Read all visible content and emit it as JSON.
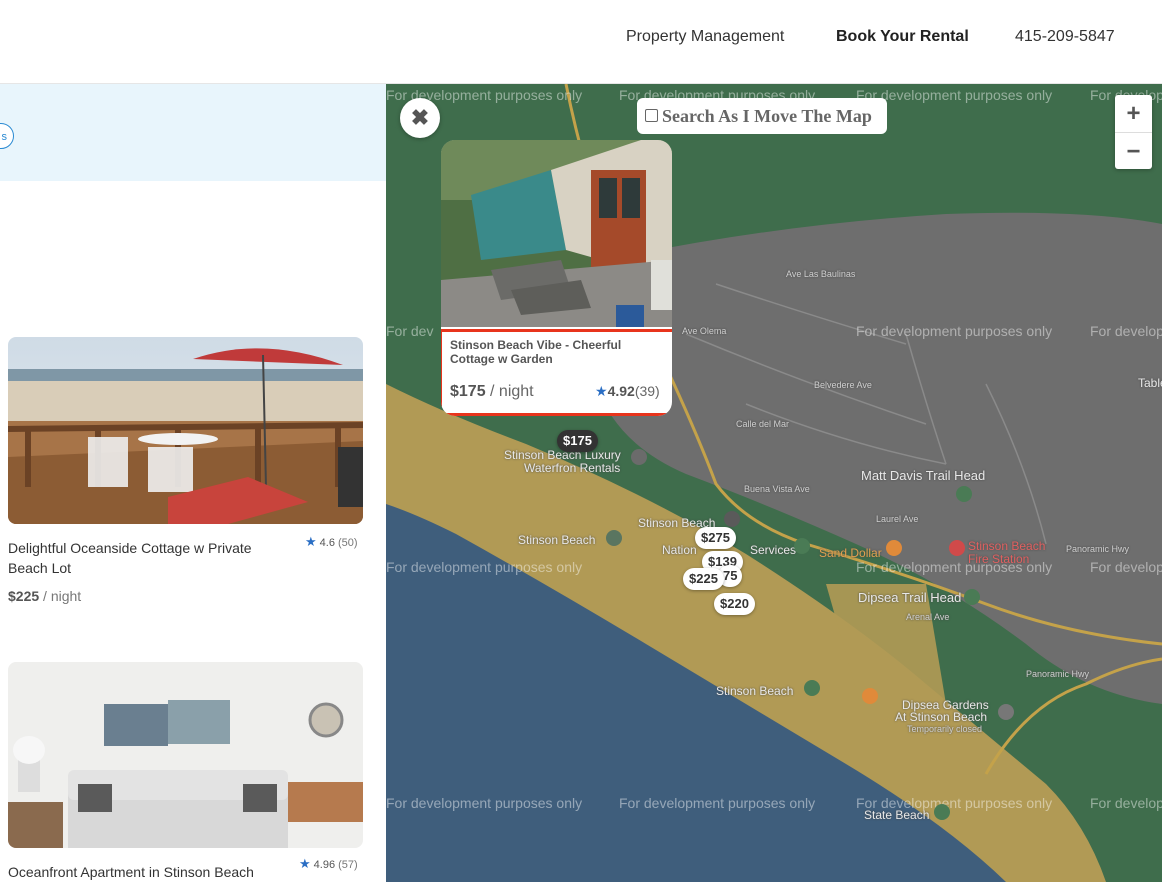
{
  "nav": {
    "property_management": "Property Management",
    "book_rental": "Book Your Rental",
    "phone": "415-209-5847"
  },
  "filter": {
    "pill_label": "s"
  },
  "listings": [
    {
      "title": "Delightful Oceanside Cottage w Private Beach Lot",
      "rating": "4.6",
      "reviews": "(50)",
      "price": "$225",
      "price_unit": " / night"
    },
    {
      "title": "Oceanfront Apartment in Stinson Beach",
      "rating": "4.96",
      "reviews": "(57)"
    }
  ],
  "map": {
    "close_icon": "✖",
    "search_as_move": "Search As I Move The Map",
    "zoom_in": "+",
    "zoom_out": "−",
    "dev_watermark": "For development purposes only",
    "dev_watermark_cut1": "For develop",
    "dev_watermark_cut2": "For dev",
    "dev_watermark_cut3": "For develo",
    "dev_watermark_cut4": "For deve",
    "popup": {
      "title": "Stinson Beach Vibe - Cheerful Cottage w Garden",
      "price": "$175",
      "price_unit": " / night",
      "rating": "4.92",
      "reviews": "(39)"
    },
    "markers": {
      "m175": "$175",
      "m275": "$275",
      "m139": "$139",
      "m225": "$225",
      "m75": "75",
      "m220": "$220"
    },
    "labels": {
      "stinson_luxury": "Stinson Beach Luxury",
      "waterfront": "Waterfron Rentals",
      "stinson_beach_poi": "Stinson Beach",
      "stinson_beach_park": "Stinson Beach",
      "stinson_beach_lower": "Stinson Beach",
      "national": "Nation",
      "services": "Services",
      "sand_dollar": "Sand Dollar",
      "fire_station_1": "Stinson Beach",
      "fire_station_2": "Fire Station",
      "matt_davis": "Matt Davis Trail Head",
      "dipsea_trail": "Dipsea Trail Head",
      "dipsea_gardens_1": "Dipsea Gardens",
      "dipsea_gardens_2": "At Stinson Beach",
      "temp_closed": "Temporarily closed",
      "state_beach": "State Beach",
      "ave_las_baulinas": "Ave Las Baulinas",
      "ave_oleme": "Ave Olema",
      "belvedere": "Belvedere Ave",
      "calle_del_mar": "Calle del Mar",
      "laurel": "Laurel Ave",
      "buena_vista": "Buena Vista Ave",
      "arenal": "Arenal Ave",
      "panoramic_hwy": "Panoramic Hwy",
      "panoramic_hwy2": "Panoramic Hwy",
      "table": "Table"
    }
  }
}
